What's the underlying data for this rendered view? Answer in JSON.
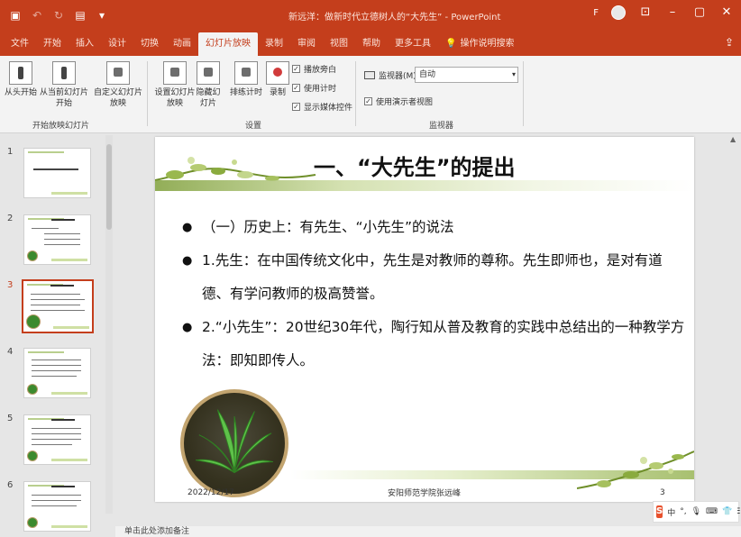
{
  "window": {
    "title": "新远洋：做新时代立德树人的“大先生” - PowerPoint",
    "user_initial": "F"
  },
  "tabs": [
    {
      "label": "文件"
    },
    {
      "label": "开始"
    },
    {
      "label": "插入"
    },
    {
      "label": "设计"
    },
    {
      "label": "切换"
    },
    {
      "label": "动画"
    },
    {
      "label": "幻灯片放映"
    },
    {
      "label": "录制"
    },
    {
      "label": "审阅"
    },
    {
      "label": "视图"
    },
    {
      "label": "帮助"
    },
    {
      "label": "更多工具"
    },
    {
      "label": "操作说明搜索"
    }
  ],
  "ribbon": {
    "start_group": {
      "from_beginning_label": "从头开始",
      "from_current_label": "从当前幻灯片开始",
      "custom_label": "自定义幻灯片放映",
      "group_label": "开始放映幻灯片"
    },
    "setup_group": {
      "setup_show_label": "设置幻灯片放映",
      "hide_slide_label": "隐藏幻灯片",
      "rehearse_label": "排练计时",
      "record_label": "录制",
      "play_narrations_label": "播放旁白",
      "use_timings_label": "使用计时",
      "show_media_label": "显示媒体控件",
      "group_label": "设置"
    },
    "monitors_group": {
      "monitor_label": "监视器(M):",
      "monitor_value": "自动",
      "presenter_view_label": "使用演示者视图",
      "group_label": "监视器"
    }
  },
  "thumbnails": [
    {
      "num": "1"
    },
    {
      "num": "2"
    },
    {
      "num": "3"
    },
    {
      "num": "4"
    },
    {
      "num": "5"
    },
    {
      "num": "6"
    }
  ],
  "slide": {
    "title": "一、“大先生”的提出",
    "bullets": [
      {
        "text": "（一）历史上：有先生、“小先生”的说法"
      },
      {
        "text": "1.先生：在中国传统文化中，先生是对教师的尊称。先生即师也，是对有道德、有学问教师的极高赞誉。"
      },
      {
        "text": "2.“小先生”：20世纪30年代，陶行知从普及教育的实践中总结出的一种教学方法：即知即传人。"
      }
    ],
    "footer_date": "2022/12/17",
    "footer_center": "安阳师范学院张远峰",
    "footer_page": "3"
  },
  "notes_placeholder": "单击此处添加备注",
  "ime": {
    "logo": "S",
    "lang": "中"
  },
  "colors": {
    "accent": "#c43e1c",
    "ribbon_bg": "#f3f3f3"
  }
}
